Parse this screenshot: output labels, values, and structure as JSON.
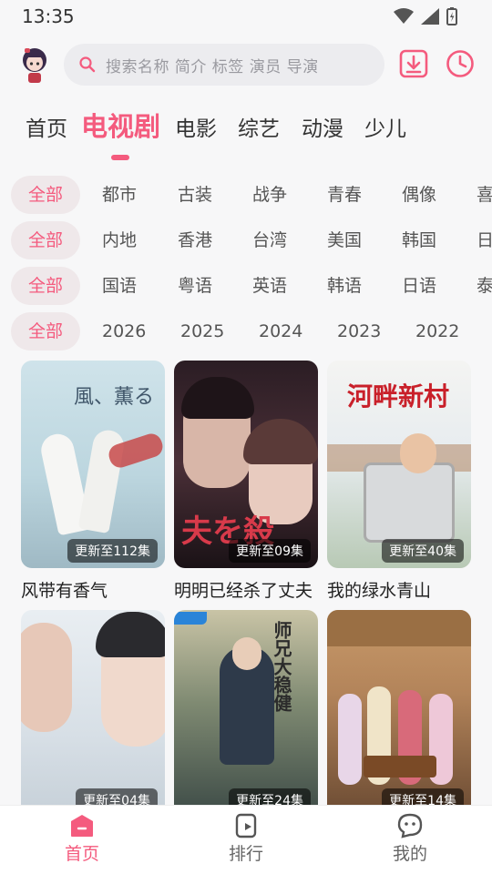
{
  "status": {
    "time": "13:35"
  },
  "search": {
    "placeholder": "搜索名称 简介 标签 演员 导演"
  },
  "tabs": [
    {
      "label": "首页"
    },
    {
      "label": "电视剧"
    },
    {
      "label": "电影"
    },
    {
      "label": "综艺"
    },
    {
      "label": "动漫"
    },
    {
      "label": "少儿"
    }
  ],
  "filters": {
    "genre": [
      "全部",
      "都市",
      "古装",
      "战争",
      "青春",
      "偶像",
      "喜"
    ],
    "region": [
      "全部",
      "内地",
      "香港",
      "台湾",
      "美国",
      "韩国",
      "日"
    ],
    "language": [
      "全部",
      "国语",
      "粤语",
      "英语",
      "韩语",
      "日语",
      "泰"
    ],
    "year": [
      "全部",
      "2026",
      "2025",
      "2024",
      "2023",
      "2022"
    ]
  },
  "cards": [
    {
      "title": "风带有香气",
      "badge": "更新至112集",
      "poster_text": "風、薫る"
    },
    {
      "title": "明明已经杀了丈夫",
      "badge": "更新至09集",
      "poster_text": "夫を殺"
    },
    {
      "title": "我的绿水青山",
      "badge": "更新至40集",
      "poster_text": "河畔新村"
    },
    {
      "title": "",
      "badge": "更新至04集",
      "poster_text": ""
    },
    {
      "title": "",
      "badge": "更新至24集",
      "poster_text": "师兄大稳健"
    },
    {
      "title": "",
      "badge": "更新至14集",
      "poster_text": ""
    }
  ],
  "bottom_nav": [
    {
      "label": "首页",
      "icon": "home-icon"
    },
    {
      "label": "排行",
      "icon": "ranking-icon"
    },
    {
      "label": "我的",
      "icon": "profile-icon"
    }
  ],
  "colors": {
    "accent": "#f45b7e",
    "background": "#f7f7f8"
  }
}
